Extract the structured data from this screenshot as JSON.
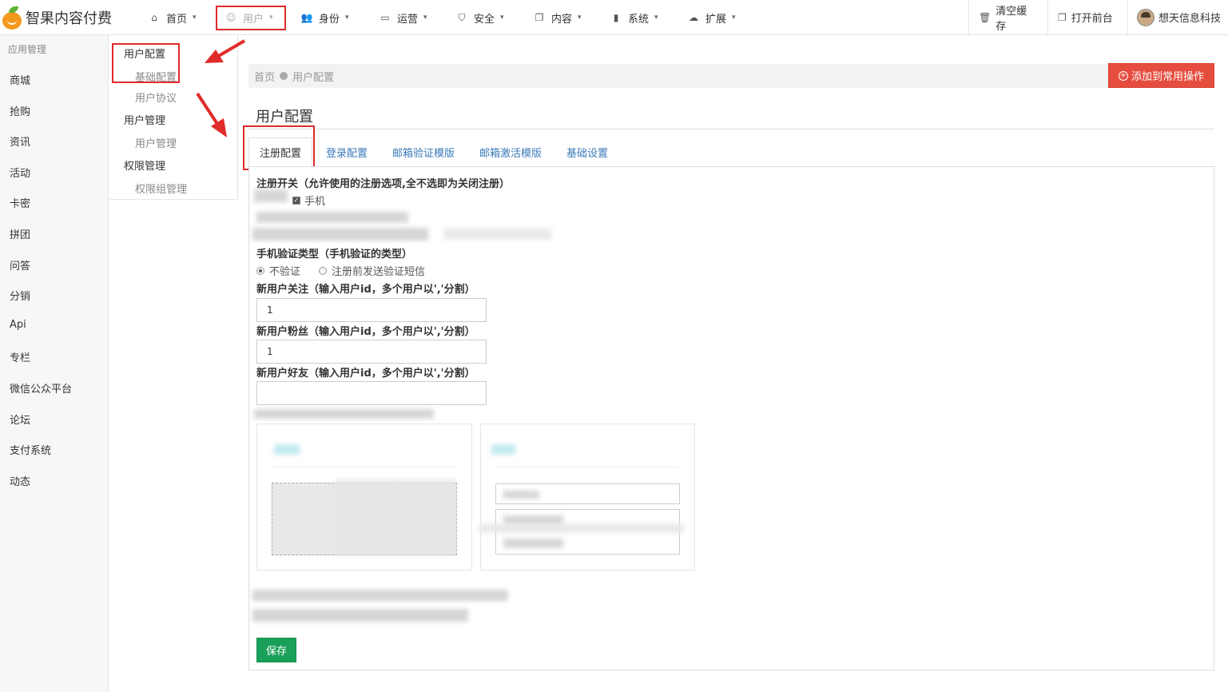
{
  "brand": {
    "name": "智果内容付费"
  },
  "topnav": [
    {
      "label": "首页",
      "icon": "home-icon",
      "active": false
    },
    {
      "label": "用户",
      "icon": "user-icon",
      "active": true
    },
    {
      "label": "身份",
      "icon": "users-icon",
      "active": false
    },
    {
      "label": "运营",
      "icon": "monitor-icon",
      "active": false
    },
    {
      "label": "安全",
      "icon": "shield-icon",
      "active": false
    },
    {
      "label": "内容",
      "icon": "copy-icon",
      "active": false
    },
    {
      "label": "系统",
      "icon": "book-icon",
      "active": false
    },
    {
      "label": "扩展",
      "icon": "cloud-icon",
      "active": false
    }
  ],
  "topright": {
    "clear_cache": "清空缓存",
    "open_frontend": "打开前台",
    "username": "想天信息科技"
  },
  "sidebar": {
    "section": "应用管理",
    "items": [
      "商城",
      "抢购",
      "资讯",
      "活动",
      "卡密",
      "拼团",
      "问答",
      "分销",
      "Api",
      "专栏",
      "微信公众平台",
      "论坛",
      "支付系统",
      "动态"
    ]
  },
  "submenu": {
    "groups": [
      {
        "title": "用户配置",
        "items": [
          "基础配置",
          "用户协议"
        ]
      },
      {
        "title": "用户管理",
        "items": [
          "用户管理"
        ]
      },
      {
        "title": "权限管理",
        "items": [
          "权限组管理"
        ]
      }
    ]
  },
  "breadcrumb": {
    "home": "首页",
    "current": "用户配置"
  },
  "add_button": "添加到常用操作",
  "page_title": "用户配置",
  "tabs": [
    "注册配置",
    "登录配置",
    "邮箱验证模版",
    "邮箱激活模版",
    "基础设置"
  ],
  "form": {
    "register_switch_label": "注册开关（允许使用的注册选项,全不选即为关闭注册）",
    "register_option_phone": "手机",
    "phone_verify_label": "手机验证类型（手机验证的类型）",
    "phone_verify_options": [
      "不验证",
      "注册前发送验证短信"
    ],
    "phone_verify_selected": 0,
    "new_user_follow_label": "新用户关注（输入用户id，多个用户以','分割）",
    "new_user_follow_value": "1",
    "new_user_fans_label": "新用户粉丝（输入用户id，多个用户以','分割）",
    "new_user_fans_value": "1",
    "new_user_friend_label": "新用户好友（输入用户id，多个用户以','分割）",
    "new_user_friend_value": ""
  },
  "save_button": "保存"
}
